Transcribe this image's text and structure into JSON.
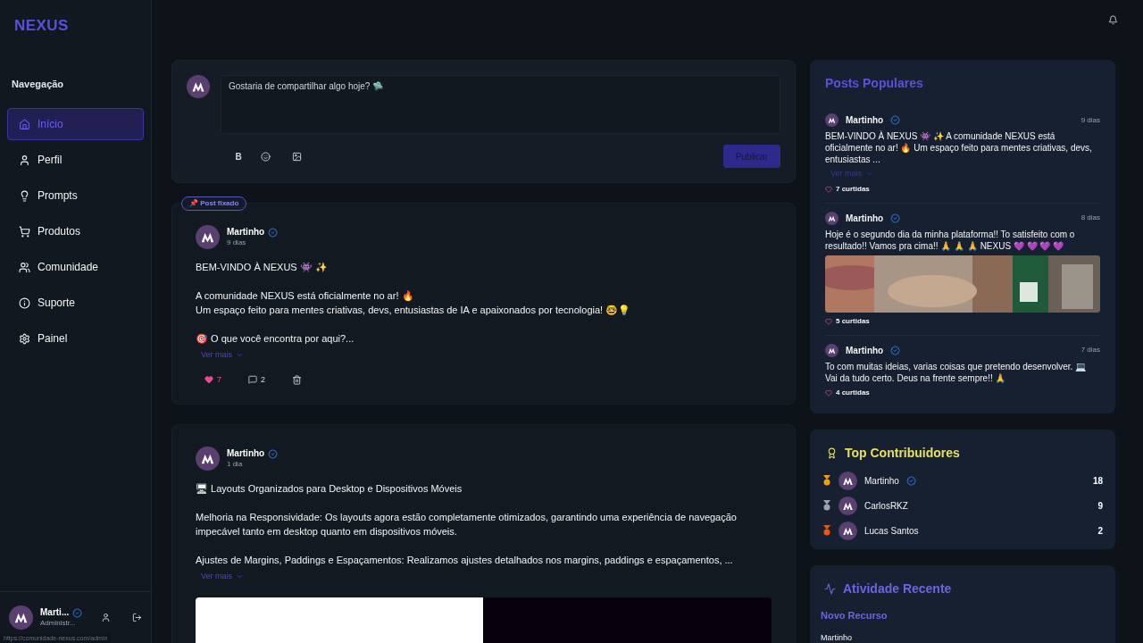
{
  "sidebar": {
    "logo": "NEXUS",
    "section": "Navegação",
    "items": [
      {
        "label": "Início",
        "selected": true
      },
      {
        "label": "Perfil",
        "selected": false
      },
      {
        "label": "Prompts",
        "selected": false
      },
      {
        "label": "Produtos",
        "selected": false
      },
      {
        "label": "Comunidade",
        "selected": false
      },
      {
        "label": "Suporte",
        "selected": false
      },
      {
        "label": "Painel",
        "selected": false
      }
    ],
    "user": {
      "name": "Marti...",
      "role": "Administr..."
    },
    "status_url": "https://comunidade-nexus.com/admin"
  },
  "composer": {
    "placeholder": "Gostaria de compartilhar algo hoje? 🛸",
    "bold": "B",
    "submit": "Publicar"
  },
  "posts": [
    {
      "badge": "📌 Post fixado",
      "author": "Martinho",
      "time": "9 dias",
      "paragraphs": [
        "BEM-VINDO À NEXUS 👾 ✨",
        "A comunidade NEXUS está oficialmente no ar! 🔥\nUm espaço feito para mentes criativas, devs, entusiastas de IA e apaixonados por tecnologia! 🤓💡",
        "🎯 O que você encontra por aqui?..."
      ],
      "more": "Ver mais",
      "likes": "7",
      "liked": true,
      "comments": "2"
    },
    {
      "author": "Martinho",
      "time": "1 dia",
      "paragraphs": [
        "🖥 Layouts Organizados para Desktop e Dispositivos Móveis",
        "Melhoria na Responsividade: Os layouts agora estão completamente otimizados, garantindo uma experiência de navegação impecável tanto em desktop quanto em dispositivos móveis.",
        "Ajustes de Margins, Paddings e Espaçamentos: Realizamos ajustes detalhados nos margins, paddings e espaçamentos, ..."
      ],
      "more": "Ver mais",
      "media": true
    }
  ],
  "popular": {
    "title": "Posts Populares",
    "posts": [
      {
        "author": "Martinho",
        "time": "9 dias",
        "text": "BEM-VINDO À NEXUS 👾 ✨ A comunidade NEXUS está oficialmente no ar! 🔥 Um espaço feito para mentes criativas, devs, entusiastas ...",
        "more": "Ver mais",
        "likes": "7 curtidas"
      },
      {
        "author": "Martinho",
        "time": "8 dias",
        "text": "Hoje é o segundo dia da minha plataforma!! To satisfeito com o resultado!! Vamos pra cima!! 🙏 🙏 🙏 NEXUS 💜 💜 💜 💜",
        "likes": "5 curtidas",
        "image": true
      },
      {
        "author": "Martinho",
        "time": "7 dias",
        "text": "To com muitas ideias, varias coisas que pretendo desenvolver. 💻 Vai da tudo certo. Deus na frente sempre!! 🙏",
        "likes": "4 curtidas"
      }
    ]
  },
  "contributors": {
    "title": "Top Contribuidores",
    "rows": [
      {
        "name": "Martinho",
        "verified": true,
        "score": "18",
        "color": "#f59e0b"
      },
      {
        "name": "CarlosRKZ",
        "verified": false,
        "score": "9",
        "color": "#9ca3af"
      },
      {
        "name": "Lucas Santos",
        "verified": false,
        "score": "2",
        "color": "#ea580c"
      }
    ]
  },
  "activity": {
    "title": "Atividade Recente",
    "kind": "Novo Recurso",
    "author": "Martinho"
  }
}
